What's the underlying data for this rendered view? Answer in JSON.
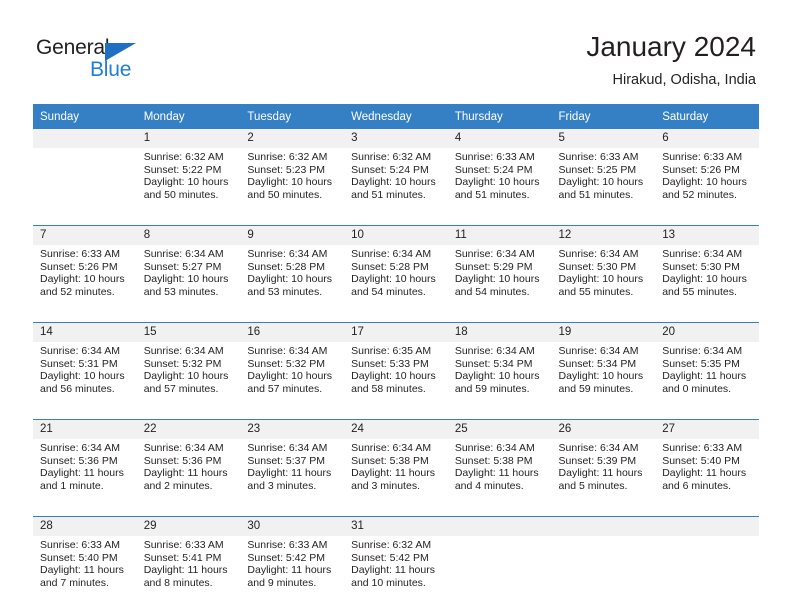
{
  "brand": {
    "name_part1": "General",
    "name_part2": "Blue",
    "accent_color": "#1f7fd4",
    "triangle_color": "#1f6fc4"
  },
  "header": {
    "title": "January 2024",
    "subtitle": "Hirakud, Odisha, India"
  },
  "theme": {
    "header_bg": "#3580c4",
    "header_text": "#ffffff",
    "daynum_bg": "#f1f1f1",
    "cell_bg": "#ffffff",
    "text_color": "#231f20"
  },
  "weekday_headers": [
    "Sunday",
    "Monday",
    "Tuesday",
    "Wednesday",
    "Thursday",
    "Friday",
    "Saturday"
  ],
  "weeks": [
    {
      "days": [
        {
          "num": "",
          "sunrise": "",
          "sunset": "",
          "daylight1": "",
          "daylight2": ""
        },
        {
          "num": "1",
          "sunrise": "Sunrise: 6:32 AM",
          "sunset": "Sunset: 5:22 PM",
          "daylight1": "Daylight: 10 hours",
          "daylight2": "and 50 minutes."
        },
        {
          "num": "2",
          "sunrise": "Sunrise: 6:32 AM",
          "sunset": "Sunset: 5:23 PM",
          "daylight1": "Daylight: 10 hours",
          "daylight2": "and 50 minutes."
        },
        {
          "num": "3",
          "sunrise": "Sunrise: 6:32 AM",
          "sunset": "Sunset: 5:24 PM",
          "daylight1": "Daylight: 10 hours",
          "daylight2": "and 51 minutes."
        },
        {
          "num": "4",
          "sunrise": "Sunrise: 6:33 AM",
          "sunset": "Sunset: 5:24 PM",
          "daylight1": "Daylight: 10 hours",
          "daylight2": "and 51 minutes."
        },
        {
          "num": "5",
          "sunrise": "Sunrise: 6:33 AM",
          "sunset": "Sunset: 5:25 PM",
          "daylight1": "Daylight: 10 hours",
          "daylight2": "and 51 minutes."
        },
        {
          "num": "6",
          "sunrise": "Sunrise: 6:33 AM",
          "sunset": "Sunset: 5:26 PM",
          "daylight1": "Daylight: 10 hours",
          "daylight2": "and 52 minutes."
        }
      ]
    },
    {
      "days": [
        {
          "num": "7",
          "sunrise": "Sunrise: 6:33 AM",
          "sunset": "Sunset: 5:26 PM",
          "daylight1": "Daylight: 10 hours",
          "daylight2": "and 52 minutes."
        },
        {
          "num": "8",
          "sunrise": "Sunrise: 6:34 AM",
          "sunset": "Sunset: 5:27 PM",
          "daylight1": "Daylight: 10 hours",
          "daylight2": "and 53 minutes."
        },
        {
          "num": "9",
          "sunrise": "Sunrise: 6:34 AM",
          "sunset": "Sunset: 5:28 PM",
          "daylight1": "Daylight: 10 hours",
          "daylight2": "and 53 minutes."
        },
        {
          "num": "10",
          "sunrise": "Sunrise: 6:34 AM",
          "sunset": "Sunset: 5:28 PM",
          "daylight1": "Daylight: 10 hours",
          "daylight2": "and 54 minutes."
        },
        {
          "num": "11",
          "sunrise": "Sunrise: 6:34 AM",
          "sunset": "Sunset: 5:29 PM",
          "daylight1": "Daylight: 10 hours",
          "daylight2": "and 54 minutes."
        },
        {
          "num": "12",
          "sunrise": "Sunrise: 6:34 AM",
          "sunset": "Sunset: 5:30 PM",
          "daylight1": "Daylight: 10 hours",
          "daylight2": "and 55 minutes."
        },
        {
          "num": "13",
          "sunrise": "Sunrise: 6:34 AM",
          "sunset": "Sunset: 5:30 PM",
          "daylight1": "Daylight: 10 hours",
          "daylight2": "and 55 minutes."
        }
      ]
    },
    {
      "days": [
        {
          "num": "14",
          "sunrise": "Sunrise: 6:34 AM",
          "sunset": "Sunset: 5:31 PM",
          "daylight1": "Daylight: 10 hours",
          "daylight2": "and 56 minutes."
        },
        {
          "num": "15",
          "sunrise": "Sunrise: 6:34 AM",
          "sunset": "Sunset: 5:32 PM",
          "daylight1": "Daylight: 10 hours",
          "daylight2": "and 57 minutes."
        },
        {
          "num": "16",
          "sunrise": "Sunrise: 6:34 AM",
          "sunset": "Sunset: 5:32 PM",
          "daylight1": "Daylight: 10 hours",
          "daylight2": "and 57 minutes."
        },
        {
          "num": "17",
          "sunrise": "Sunrise: 6:35 AM",
          "sunset": "Sunset: 5:33 PM",
          "daylight1": "Daylight: 10 hours",
          "daylight2": "and 58 minutes."
        },
        {
          "num": "18",
          "sunrise": "Sunrise: 6:34 AM",
          "sunset": "Sunset: 5:34 PM",
          "daylight1": "Daylight: 10 hours",
          "daylight2": "and 59 minutes."
        },
        {
          "num": "19",
          "sunrise": "Sunrise: 6:34 AM",
          "sunset": "Sunset: 5:34 PM",
          "daylight1": "Daylight: 10 hours",
          "daylight2": "and 59 minutes."
        },
        {
          "num": "20",
          "sunrise": "Sunrise: 6:34 AM",
          "sunset": "Sunset: 5:35 PM",
          "daylight1": "Daylight: 11 hours",
          "daylight2": "and 0 minutes."
        }
      ]
    },
    {
      "days": [
        {
          "num": "21",
          "sunrise": "Sunrise: 6:34 AM",
          "sunset": "Sunset: 5:36 PM",
          "daylight1": "Daylight: 11 hours",
          "daylight2": "and 1 minute."
        },
        {
          "num": "22",
          "sunrise": "Sunrise: 6:34 AM",
          "sunset": "Sunset: 5:36 PM",
          "daylight1": "Daylight: 11 hours",
          "daylight2": "and 2 minutes."
        },
        {
          "num": "23",
          "sunrise": "Sunrise: 6:34 AM",
          "sunset": "Sunset: 5:37 PM",
          "daylight1": "Daylight: 11 hours",
          "daylight2": "and 3 minutes."
        },
        {
          "num": "24",
          "sunrise": "Sunrise: 6:34 AM",
          "sunset": "Sunset: 5:38 PM",
          "daylight1": "Daylight: 11 hours",
          "daylight2": "and 3 minutes."
        },
        {
          "num": "25",
          "sunrise": "Sunrise: 6:34 AM",
          "sunset": "Sunset: 5:38 PM",
          "daylight1": "Daylight: 11 hours",
          "daylight2": "and 4 minutes."
        },
        {
          "num": "26",
          "sunrise": "Sunrise: 6:34 AM",
          "sunset": "Sunset: 5:39 PM",
          "daylight1": "Daylight: 11 hours",
          "daylight2": "and 5 minutes."
        },
        {
          "num": "27",
          "sunrise": "Sunrise: 6:33 AM",
          "sunset": "Sunset: 5:40 PM",
          "daylight1": "Daylight: 11 hours",
          "daylight2": "and 6 minutes."
        }
      ]
    },
    {
      "days": [
        {
          "num": "28",
          "sunrise": "Sunrise: 6:33 AM",
          "sunset": "Sunset: 5:40 PM",
          "daylight1": "Daylight: 11 hours",
          "daylight2": "and 7 minutes."
        },
        {
          "num": "29",
          "sunrise": "Sunrise: 6:33 AM",
          "sunset": "Sunset: 5:41 PM",
          "daylight1": "Daylight: 11 hours",
          "daylight2": "and 8 minutes."
        },
        {
          "num": "30",
          "sunrise": "Sunrise: 6:33 AM",
          "sunset": "Sunset: 5:42 PM",
          "daylight1": "Daylight: 11 hours",
          "daylight2": "and 9 minutes."
        },
        {
          "num": "31",
          "sunrise": "Sunrise: 6:32 AM",
          "sunset": "Sunset: 5:42 PM",
          "daylight1": "Daylight: 11 hours",
          "daylight2": "and 10 minutes."
        },
        {
          "num": "",
          "sunrise": "",
          "sunset": "",
          "daylight1": "",
          "daylight2": ""
        },
        {
          "num": "",
          "sunrise": "",
          "sunset": "",
          "daylight1": "",
          "daylight2": ""
        },
        {
          "num": "",
          "sunrise": "",
          "sunset": "",
          "daylight1": "",
          "daylight2": ""
        }
      ]
    }
  ]
}
